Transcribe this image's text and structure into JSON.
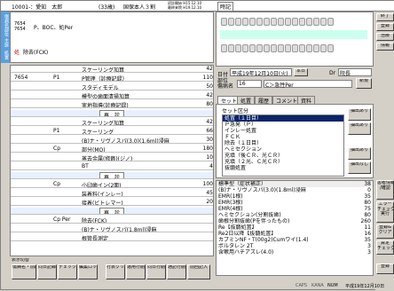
{
  "header": {
    "patient_id": "10001-：愛知　太郎",
    "age": "(33歳)",
    "insurance": "国保本人３割",
    "dates": "初診開始 H15.12.10\n最終来院 H19.12.10",
    "status": "時記"
  },
  "side_labels": [
    "傷病名部位",
    "主訴",
    "処置"
  ],
  "diagnosis": {
    "tooth_label": "7654\n7654",
    "text": "P、BOC、処Per",
    "marker": "処",
    "treatment": "除去(FCK)"
  },
  "records": [
    {
      "label": "スケーリング加算",
      "value": "42"
    },
    {
      "tooth": "7654",
      "code": "P1",
      "label": "P管理（診療記録）",
      "value": "110"
    },
    {
      "label": "スタディモデル",
      "value": "50"
    },
    {
      "label": "模型の歯面清掃加算",
      "value": "42"
    },
    {
      "label": "実地指導(診療記録)",
      "value": "80"
    },
    {
      "label": "再　診",
      "value": "",
      "center": true
    },
    {
      "label": "スケーリング加算",
      "value": "42"
    },
    {
      "code": "P1",
      "label": "スケーリング",
      "value": "66"
    },
    {
      "label": "(B)ナ・リヴノスパ(3.0)(1.6ml)浸麻",
      "value": "30"
    },
    {
      "code": "Cp",
      "label": "部分(MO)",
      "value": "180"
    },
    {
      "label": "蒸去金属(修飾)(ジノ)",
      "value": "10"
    },
    {
      "label": "BT",
      "value": "4"
    },
    {
      "label": "再　診",
      "value": "",
      "center": true
    },
    {
      "code": "Cp",
      "label": "小臼歯イン(2面)",
      "value": "100"
    },
    {
      "label": "装着料(インレー)",
      "value": "45"
    },
    {
      "label": "接着(ビトレマー)",
      "value": "20"
    },
    {
      "label": "再　診",
      "value": "",
      "center": true
    },
    {
      "code": "Cp Per",
      "label": "除去(FCK)",
      "value": ""
    },
    {
      "label": "(B)ナ・リヴノスパ(1.8ml)浸麻",
      "value": ""
    },
    {
      "label": "根管長測定",
      "value": ""
    }
  ],
  "date_groups": [
    {
      "label": "平成\n12/5"
    },
    {
      "label": "平成\n12/6"
    },
    {
      "label": "平成\n12/7"
    },
    {
      "label": "平成\n12/8"
    }
  ],
  "bottom_buttons": [
    "表示切替",
    "傷病名・前段",
    "同日記録",
    "チェック",
    "編集ロック",
    "行表クリア",
    "運用行削除",
    "同日行削除",
    "通記行削除",
    "前回記入"
  ],
  "right_panel": {
    "date_label": "日付",
    "date_value": "平成19年12月10日(火)",
    "today_btn": "本日",
    "dr_label": "Dr",
    "dr_value": "院長",
    "site_label": "部位\n傷病名",
    "site_value": "16",
    "site_diag": "C＞急性Per",
    "new_btn": "新規",
    "tabs": [
      "セット",
      "処置",
      "履歴",
      "コメント",
      "資料"
    ],
    "set_label": "セット区分",
    "set_items": [
      "処置（１日目）",
      "Ｐ急発（Ｐ）",
      "インレー処置",
      "ＦＣＫ",
      "除去（１日目）",
      "ヘミセクション",
      "充填（後ＣＲ、光ＣＲ）",
      "充填（２光、Ｃ光ＣＲ）",
      "抜髄処置"
    ],
    "side_btns": [
      "抽出あり",
      "抽出あり",
      "抽出あり",
      "抽出なし"
    ],
    "detail_header": [
      "標準型（症状補正）",
      "38"
    ],
    "details": [
      {
        "t": "(B)ナ・リヴノスパ(3.0)(1.8ml)浸麻",
        "v": "0"
      },
      {
        "t": "EMR(1根)",
        "v": "35"
      },
      {
        "t": "EMR(3根)",
        "v": "80"
      },
      {
        "t": "EMR(4根)",
        "v": "75"
      },
      {
        "t": "ヘミセクション(分割抜歯)",
        "v": "80"
      },
      {
        "t": "歯根分割抜歯(Pを伴ったもの)",
        "v": "260"
      },
      {
        "t": "Re【抜髄処置】",
        "v": "11"
      },
      {
        "t": "Re2日以降【抜髄処置】",
        "v": "16"
      },
      {
        "t": "カプミンNF・T(00g2)Cumワイ(1.4)",
        "v": "35"
      },
      {
        "t": "ポルタレン 2T",
        "v": "3"
      },
      {
        "t": "含嗽用ハチアズレ(4.0)",
        "v": "3"
      }
    ]
  },
  "far_right": {
    "top_btns": [
      "終了",
      "登録",
      "治療",
      "情報"
    ],
    "btns": [
      "患者情報\n/確認",
      "エラー\nチェック\n実行",
      "登録&\nクリア",
      "算定\nチェック"
    ],
    "bottom": "登録"
  },
  "status_bar": {
    "caps": "CAPS",
    "kana": "KANA",
    "num": "NUM",
    "date": "平成19年12月10日"
  },
  "colors": {
    "accent": "#5aa0e0",
    "selection": "#0a246a",
    "panel": "#d4d0c8"
  }
}
